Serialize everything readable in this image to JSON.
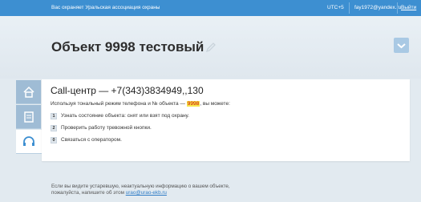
{
  "topbar": {
    "brand": "Вас охраняет Уральская ассоциация охраны",
    "timezone": "UTC+5",
    "email": "fay1972@yandex.ru",
    "logout": "Выйти"
  },
  "header": {
    "title": "Объект 9998 тестовый"
  },
  "card": {
    "call_title": "Call-центр — +7(343)3834949,,130",
    "intro_before": "Используя тональный режим телефона и № объекта —",
    "intro_object": "9998",
    "intro_after": ", вы можете:",
    "options": [
      {
        "num": "1",
        "text": "Узнать состояние объекта: снят или взят под охрану."
      },
      {
        "num": "2",
        "text": "Проверить работу тревожной кнопки."
      },
      {
        "num": "0",
        "text": "Связаться с оператором."
      }
    ]
  },
  "footer": {
    "line1": "Если вы видите устаревшую, неактуальную информацию о вашем объекте,",
    "line2_before": "пожалуйста, напишите об этом",
    "email": "urao@urao-ekb.ru"
  },
  "colors": {
    "topbar": "#3d8fd1",
    "tab": "#9fbcd5",
    "highlight": "#f7e64a"
  },
  "icons": [
    "home-icon",
    "document-icon",
    "headset-icon",
    "pencil-icon",
    "chevron-down-icon"
  ]
}
